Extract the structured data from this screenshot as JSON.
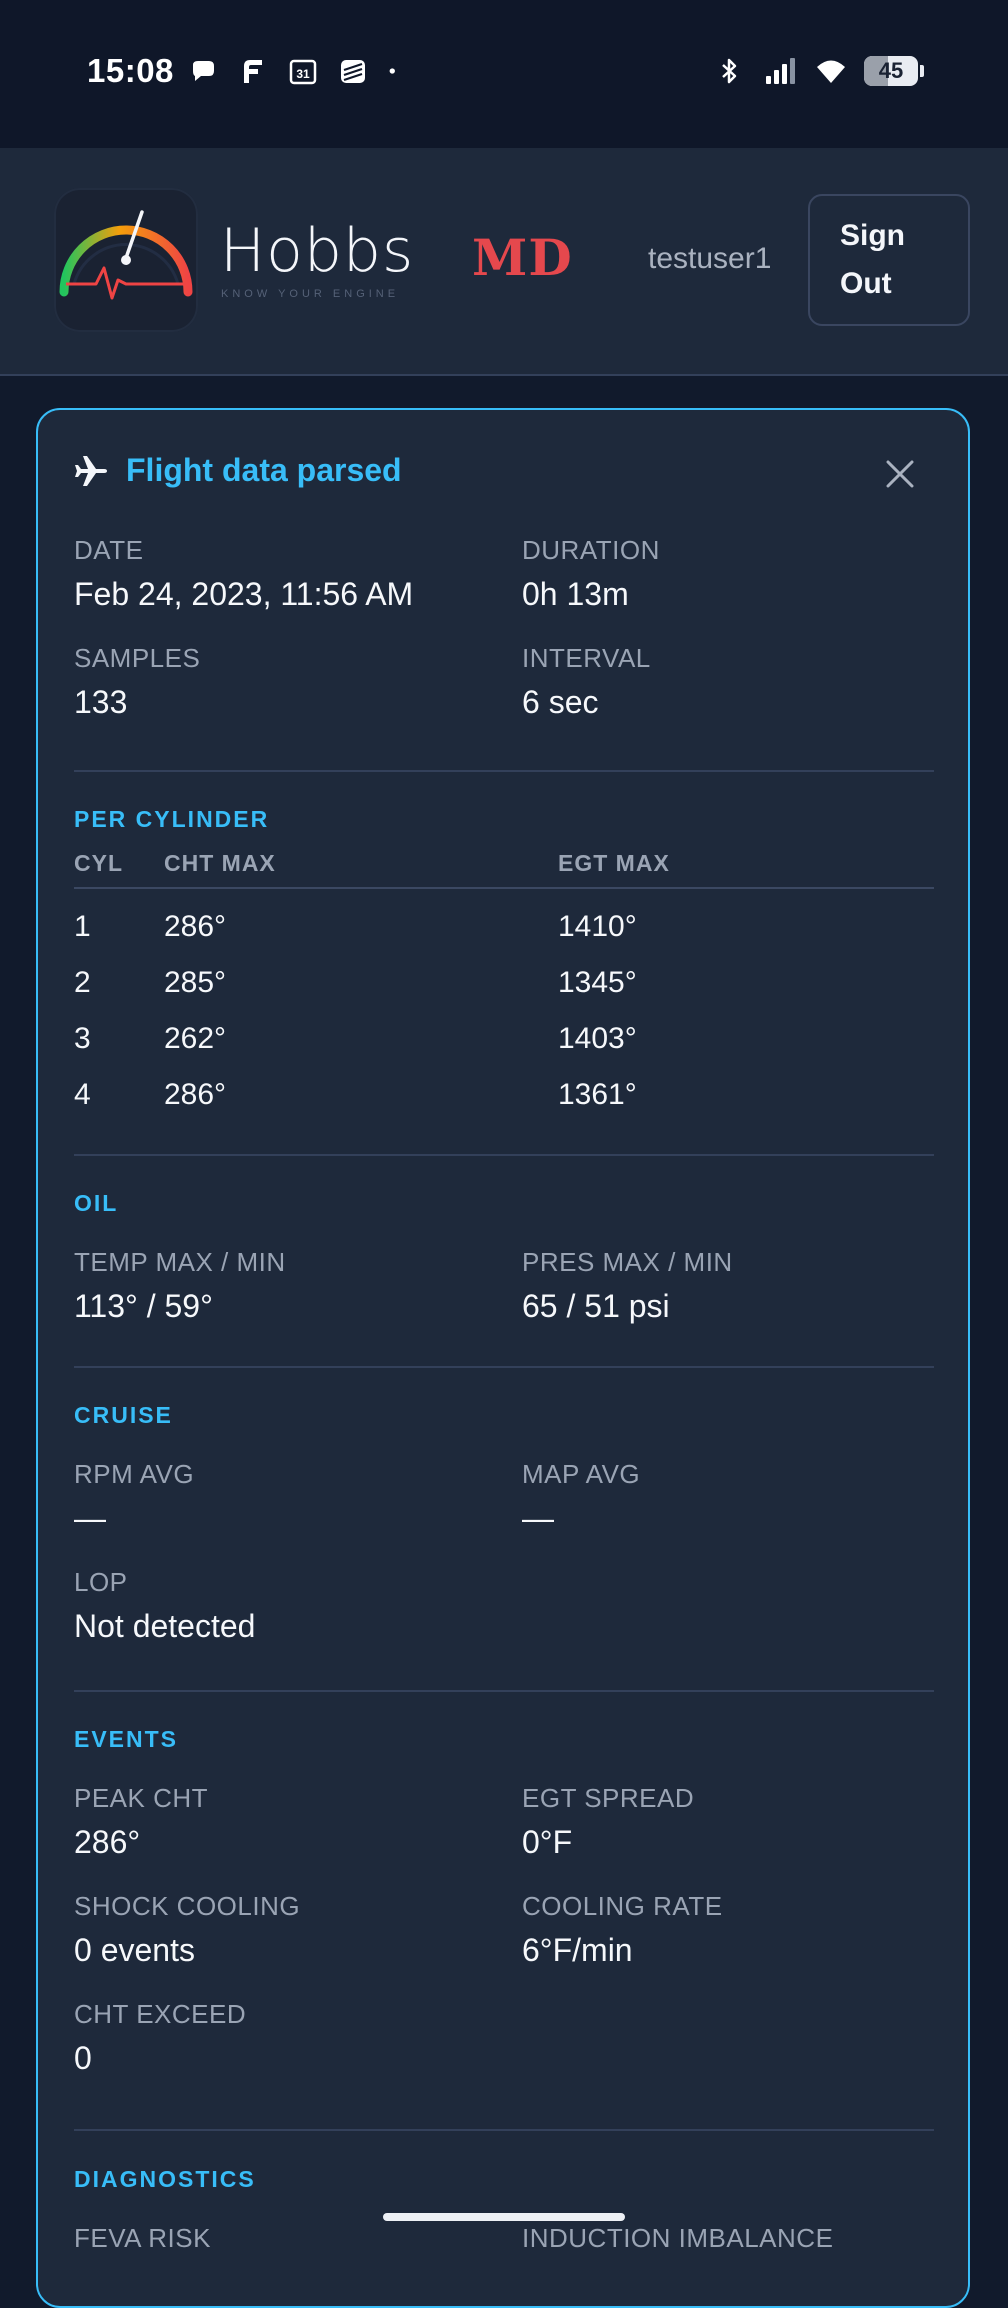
{
  "status_bar": {
    "time": "15:08",
    "left_icons": [
      "chat-bubble-icon",
      "f-app-icon",
      "calendar-31-icon",
      "stacked-app-icon",
      "dot-icon"
    ],
    "right_icons": [
      "bluetooth-icon",
      "signal-icon",
      "wifi-icon"
    ],
    "battery": "45",
    "battery_level": 0.45
  },
  "header": {
    "brand_name": "Hobbs",
    "brand_tagline": "KNOW YOUR ENGINE",
    "badge": "MD",
    "username": "testuser1",
    "sign_out_line1": "Sign",
    "sign_out_line2": "Out"
  },
  "card": {
    "title": "Flight data parsed",
    "summary": {
      "date_label": "DATE",
      "date_value": "Feb 24, 2023, 11:56 AM",
      "duration_label": "DURATION",
      "duration_value": "0h 13m",
      "samples_label": "SAMPLES",
      "samples_value": "133",
      "interval_label": "INTERVAL",
      "interval_value": "6 sec"
    },
    "per_cylinder": {
      "title": "PER CYLINDER",
      "headers": [
        "CYL",
        "CHT MAX",
        "EGT MAX"
      ],
      "rows": [
        [
          "1",
          "286°",
          "1410°"
        ],
        [
          "2",
          "285°",
          "1345°"
        ],
        [
          "3",
          "262°",
          "1403°"
        ],
        [
          "4",
          "286°",
          "1361°"
        ]
      ]
    },
    "oil": {
      "title": "OIL",
      "temp_label": "TEMP MAX / MIN",
      "temp_value": "113° / 59°",
      "pres_label": "PRES MAX / MIN",
      "pres_value": "65 / 51 psi"
    },
    "cruise": {
      "title": "CRUISE",
      "rpm_label": "RPM AVG",
      "rpm_value": "—",
      "map_label": "MAP AVG",
      "map_value": "—",
      "lop_label": "LOP",
      "lop_value": "Not detected"
    },
    "events": {
      "title": "EVENTS",
      "peak_cht_label": "PEAK CHT",
      "peak_cht_value": "286°",
      "egt_spread_label": "EGT SPREAD",
      "egt_spread_value": "0°F",
      "shock_label": "SHOCK COOLING",
      "shock_value": "0 events",
      "cooling_rate_label": "COOLING RATE",
      "cooling_rate_value": "6°F/min",
      "cht_exceed_label": "CHT EXCEED",
      "cht_exceed_value": "0"
    },
    "diagnostics": {
      "title": "DIAGNOSTICS",
      "feva_label": "FEVA RISK",
      "induction_label": "INDUCTION IMBALANCE"
    }
  },
  "colors": {
    "accent": "#38bdf8",
    "background": "#111a2c",
    "surface": "#1e293b",
    "badge": "#e5484d"
  }
}
